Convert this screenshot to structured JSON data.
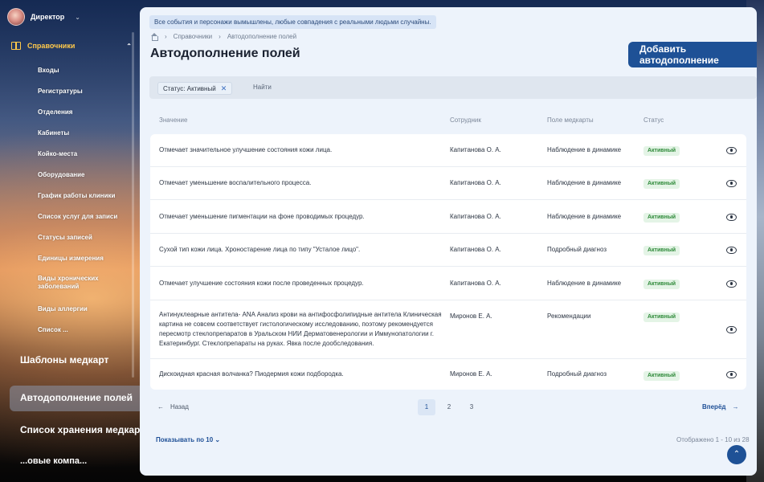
{
  "user": {
    "role": "Директор"
  },
  "sidebar": {
    "section": "Справочники",
    "items": [
      "Входы",
      "Регистратуры",
      "Отделения",
      "Кабинеты",
      "Койко-места",
      "Оборудование",
      "График работы клиники",
      "Список услуг для записи",
      "Статусы записей",
      "Единицы измерения",
      "Виды хронических заболеваний",
      "Виды аллергии",
      "Список ..."
    ],
    "lower_items": [
      "Шаблоны медкарт",
      "Автодополнение полей",
      "Список хранения медкарт",
      "...овые компа..."
    ],
    "active_item": "Автодополнение полей"
  },
  "main": {
    "notice": "Все события и персонажи вымышлены, любые совпадения с реальными людьми случайны.",
    "breadcrumb": [
      "Справочники",
      "Автодополнение полей"
    ],
    "title": "Автодополнение полей",
    "add_button": "Добавить автодополнение",
    "filter": {
      "chip": "Статус: Активный",
      "find": "Найти"
    }
  },
  "table": {
    "headers": {
      "value": "Значение",
      "employee": "Сотрудник",
      "field": "Поле медкарты",
      "status": "Статус"
    },
    "rows": [
      {
        "value": "Отмечает значительное улучшение состояния кожи лица.",
        "employee": "Капитанова О. А.",
        "field": "Наблюдение в динамике",
        "status": "Активный"
      },
      {
        "value": "Отмечает уменьшение воспалительного процесса.",
        "employee": "Капитанова О. А.",
        "field": "Наблюдение в динамике",
        "status": "Активный"
      },
      {
        "value": "Отмечает уменьшение пигментации на фоне проводимых процедур.",
        "employee": "Капитанова О. А.",
        "field": "Наблюдение в динамике",
        "status": "Активный"
      },
      {
        "value": "Сухой тип кожи лица. Хроностарение лица по типу \"Усталое лицо\".",
        "employee": "Капитанова О. А.",
        "field": "Подробный диагноз",
        "status": "Активный"
      },
      {
        "value": "Отмечает улучшение состояния кожи после проведенных процедур.",
        "employee": "Капитанова О. А.",
        "field": "Наблюдение в динамике",
        "status": "Активный"
      },
      {
        "value": "Антинуклеарные антитела- ANA Анализ крови на антифосфолипидные антитела Клиническая картина не совсем соответствует гистологическому исследованию, поэтому рекомендуется пересмотр стеклопрепаратов в Уральском НИИ Дерматовенерологии и Иммунопатологии г. Екатеринбург. Стеклопрепараты на руках. Явка после дообследования.",
        "employee": "Миронов Е. А.",
        "field": "Рекомендации",
        "status": "Активный"
      },
      {
        "value": "Дискоидная красная волчанка? Пиодермия кожи подбородка.",
        "employee": "Миронов Е. А.",
        "field": "Подробный диагноз",
        "status": "Активный"
      }
    ]
  },
  "pagination": {
    "prev": "Назад",
    "next": "Вперёд",
    "pages": [
      "1",
      "2",
      "3"
    ],
    "current": "1",
    "per_page": "Показывать по 10",
    "shown": "Отображено 1 - 10 из 28"
  },
  "colors": {
    "accent": "#1e5196",
    "status_green": "#2f8a3a",
    "section_yellow": "#ffc94a"
  }
}
